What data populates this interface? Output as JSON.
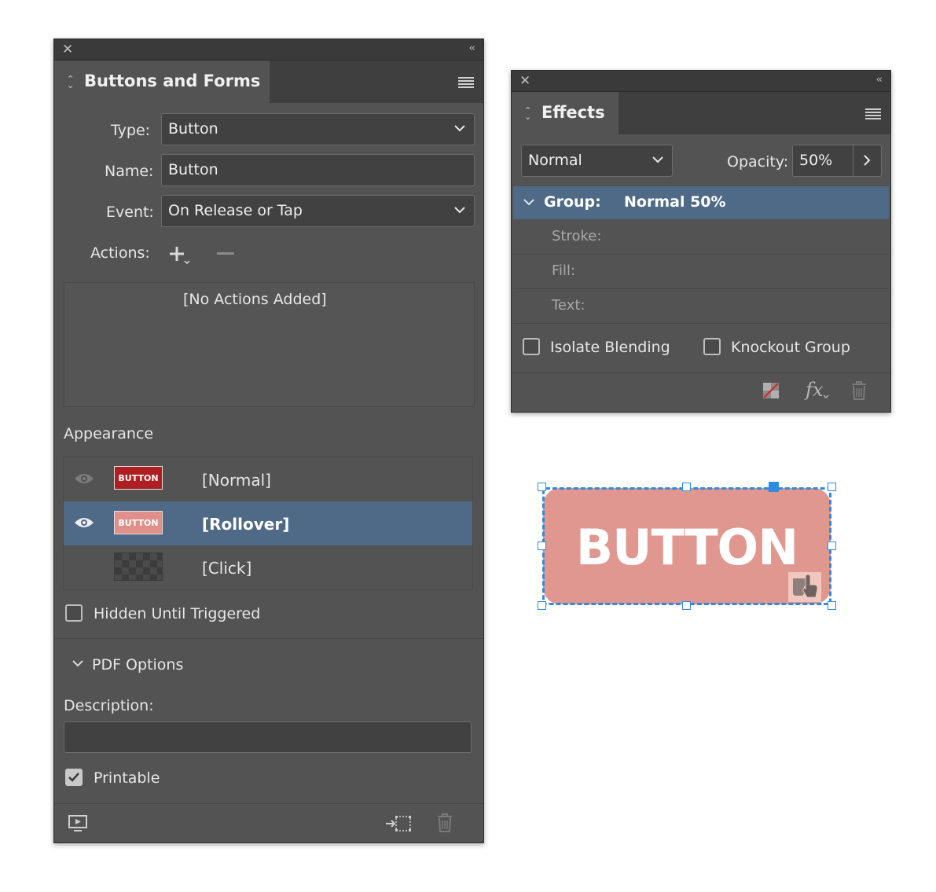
{
  "buttons_panel": {
    "title": "Buttons and Forms",
    "type_label": "Type:",
    "type_value": "Button",
    "name_label": "Name:",
    "name_value": "Button",
    "event_label": "Event:",
    "event_value": "On Release or Tap",
    "actions_label": "Actions:",
    "no_actions": "[No Actions Added]",
    "appearance_label": "Appearance",
    "states": [
      {
        "label": "[Normal]",
        "thumb_text": "BUTTON",
        "thumb_color": "#b01e23",
        "selected": false
      },
      {
        "label": "[Rollover]",
        "thumb_text": "BUTTON",
        "thumb_color": "#e0908a",
        "selected": true
      },
      {
        "label": "[Click]",
        "thumb_text": "",
        "thumb_color": "",
        "selected": false
      }
    ],
    "hidden_until_triggered": "Hidden Until Triggered",
    "pdf_options": "PDF Options",
    "description_label": "Description:",
    "description_value": "",
    "printable_label": "Printable",
    "printable_checked": true,
    "hidden_checked": false
  },
  "effects_panel": {
    "title": "Effects",
    "blend_mode": "Normal",
    "opacity_label": "Opacity:",
    "opacity_value": "50%",
    "group_label": "Group:",
    "group_value": "Normal 50%",
    "rows": [
      "Stroke:",
      "Fill:",
      "Text:"
    ],
    "isolate_blending": "Isolate Blending",
    "knockout_group": "Knockout Group",
    "fx_label": "fx"
  },
  "canvas_button": {
    "text": "BUTTON",
    "fill_color": "#e0978f",
    "selection_color": "#2f8ae0"
  },
  "colors": {
    "panel_bg": "#535353",
    "selected_row": "#4e6a87",
    "accent": "#2f8ae0"
  }
}
